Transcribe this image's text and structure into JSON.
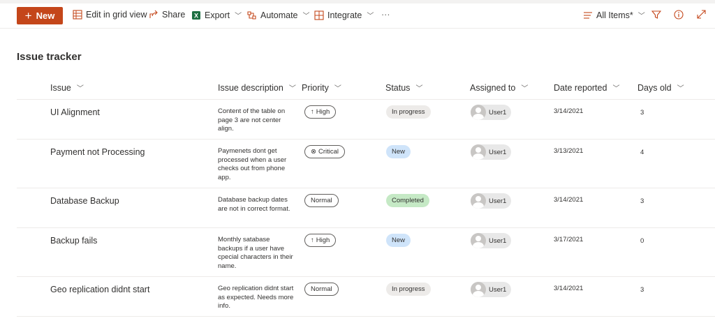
{
  "toolbar": {
    "new_label": "New",
    "edit_grid_label": "Edit in grid view",
    "share_label": "Share",
    "export_label": "Export",
    "automate_label": "Automate",
    "integrate_label": "Integrate",
    "more_label": "···",
    "view_label": "All Items*",
    "accent_color": "#c4461a",
    "excel_color": "#1d6f42"
  },
  "page": {
    "title": "Issue tracker"
  },
  "columns": {
    "issue": "Issue",
    "description": "Issue description",
    "priority": "Priority",
    "status": "Status",
    "assigned": "Assigned to",
    "date": "Date reported",
    "days": "Days old"
  },
  "rows": [
    {
      "issue": "UI Alignment",
      "description": "Content of the table on page 3 are not center align.",
      "priority": "High",
      "priority_icon": "arrow-up-icon",
      "status": "In progress",
      "status_color": "#edebe9",
      "assigned": "User1",
      "date": "3/14/2021",
      "days": "3"
    },
    {
      "issue": "Payment not Processing",
      "description": "Paymenets dont get processed when a user checks out from phone app.",
      "priority": "Critical",
      "priority_icon": "circle-x-icon",
      "status": "New",
      "status_color": "#cfe4fa",
      "assigned": "User1",
      "date": "3/13/2021",
      "days": "4"
    },
    {
      "issue": "Database Backup",
      "description": "Database backup dates are not in correct format.",
      "priority": "Normal",
      "priority_icon": "",
      "status": "Completed",
      "status_color": "#c5e9c5",
      "assigned": "User1",
      "date": "3/14/2021",
      "days": "3"
    },
    {
      "issue": "Backup fails",
      "description": "Monthly satabase backups if a user have cpecial characters in their name.",
      "priority": "High",
      "priority_icon": "arrow-up-icon",
      "status": "New",
      "status_color": "#cfe4fa",
      "assigned": "User1",
      "date": "3/17/2021",
      "days": "0"
    },
    {
      "issue": "Geo replication didnt start",
      "description": "Geo replication didnt start as expected. Needs more info.",
      "priority": "Normal",
      "priority_icon": "",
      "status": "In progress",
      "status_color": "#edebe9",
      "assigned": "User1",
      "date": "3/14/2021",
      "days": "3"
    }
  ]
}
